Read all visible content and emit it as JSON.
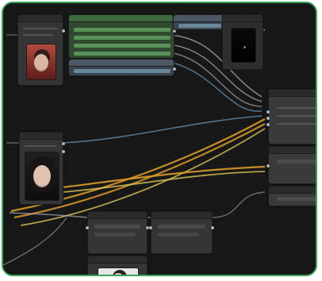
{
  "app": {
    "name": "",
    "theme_colors": {
      "background": "#171717",
      "node": "#353535",
      "node_header": "#2b2b2b",
      "frame_border": "#3aa35a",
      "wire_blue": "#5f8fb0",
      "wire_orange": "#d99a2b",
      "wire_yellow": "#d9c35a",
      "wire_gray": "#a7b0b8"
    }
  },
  "workflow": {
    "node_titles": []
  }
}
